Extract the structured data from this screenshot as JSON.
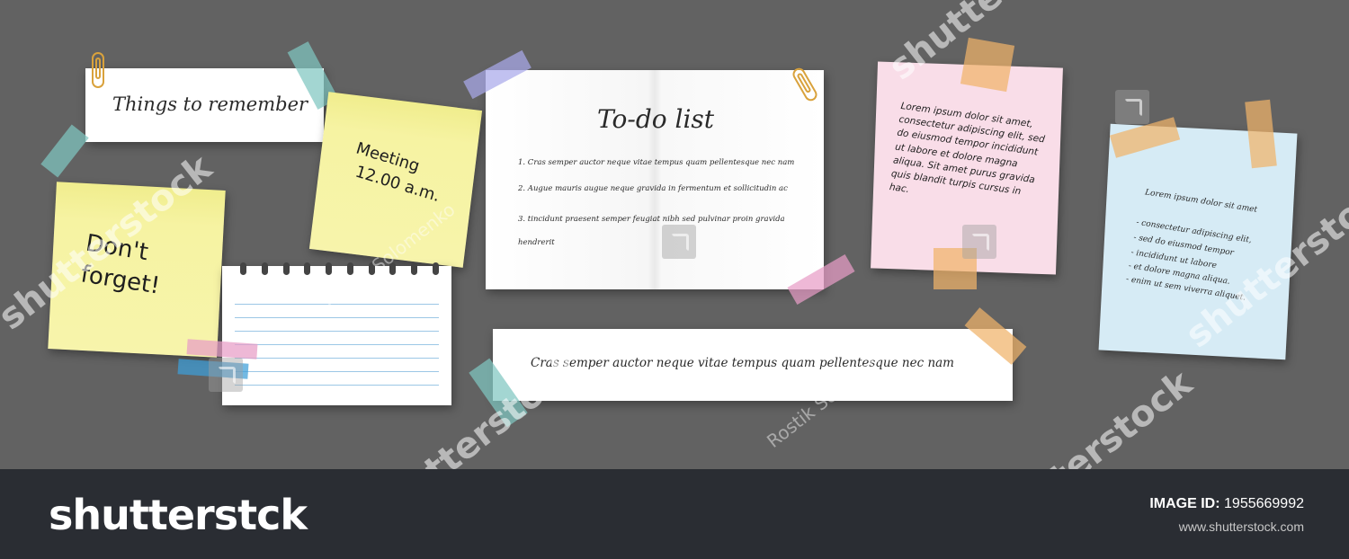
{
  "notes": {
    "things": "Things to remember",
    "dont_forget": "Don't\nforget!",
    "meeting_line1": "Meeting",
    "meeting_line2": "12.00 a.m.",
    "todo_title": "To-do list",
    "todo_items": [
      "1. Cras semper auctor neque vitae tempus quam pellentesque nec nam",
      "2. Augue mauris augue neque gravida in fermentum et sollicitudin ac",
      "3. tincidunt praesent semper feugiat nibh sed pulvinar proin gravida hendrerit"
    ],
    "strip_text": "Cras semper auctor neque vitae tempus quam pellentesque nec nam",
    "pink_text": "Lorem ipsum dolor sit amet, consectetur adipiscing elit, sed do eiusmod tempor incididunt ut labore et dolore magna aliqua. Sit amet purus gravida quis blandit turpis cursus in hac.",
    "blue_title": "Lorem ipsum dolor sit amet",
    "blue_items": [
      "- consectetur adipiscing elit,",
      "- sed do eiusmod tempor",
      "- incididunt ut labore",
      "- et dolore magna aliqua.",
      "- enim ut sem viverra aliquet."
    ]
  },
  "watermark": {
    "brand": "shutterstock",
    "author": "Rostik Solomenko"
  },
  "footer": {
    "logo": "shutterstck",
    "image_id_label": "IMAGE ID:",
    "image_id_value": "1955669992",
    "site": "www.shutterstock.com"
  },
  "colors": {
    "board": "#626262",
    "yellow_note": "#f6f3a2",
    "pink_note": "#f9dde8",
    "blue_note": "#d6ebf5",
    "tape_teal": "#7fc6c1",
    "tape_orange": "#f0b36a",
    "tape_purple": "#a9a9ea",
    "tape_pink": "#e79cc6",
    "tape_blue": "#3d9ed8",
    "footer": "#2a2d33"
  }
}
